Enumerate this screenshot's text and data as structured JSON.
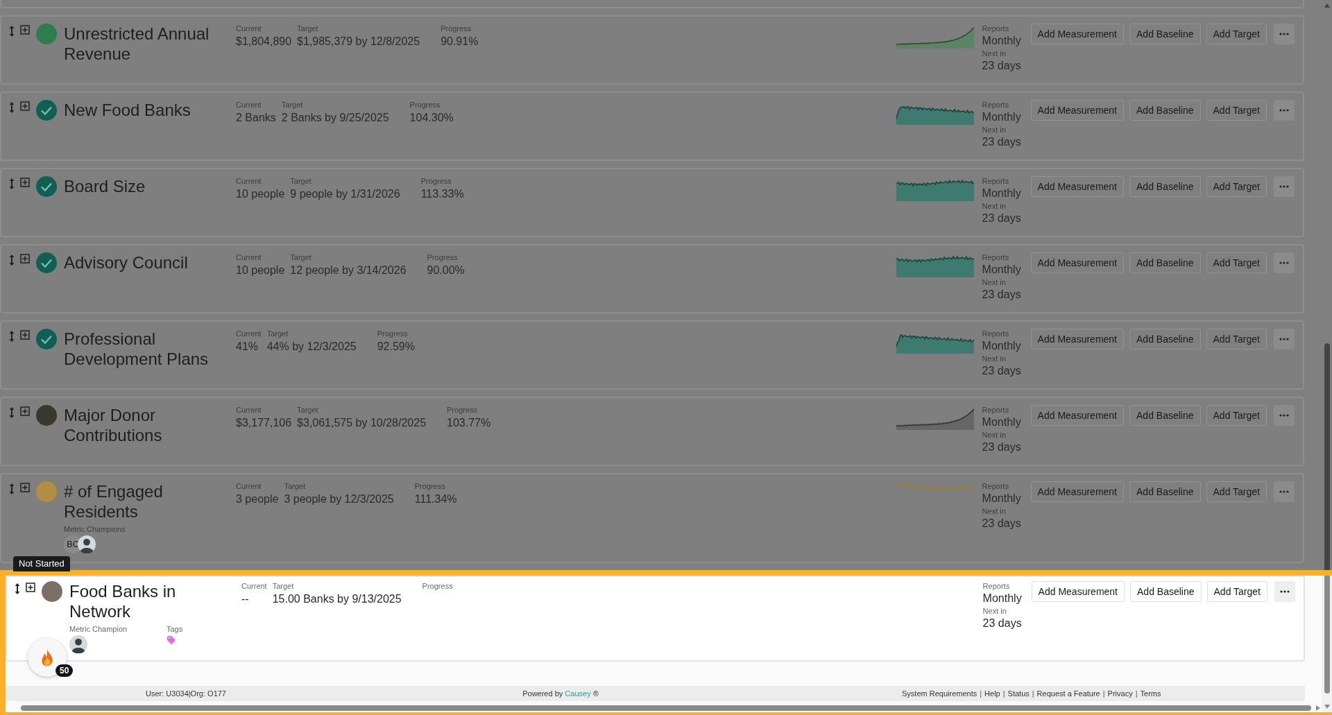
{
  "metrics": [
    {
      "title": "Unrestricted Annual Revenue",
      "status": {
        "kind": "dot",
        "color": "#2e7d4f"
      },
      "highlighted": false,
      "current_label": "Current",
      "current": "$1,804,890",
      "target_label": "Target",
      "target": "$1,985,379 by 12/8/2025",
      "progress_label": "Progress",
      "progress": "90.91%",
      "sparkline": {
        "kind": "area",
        "color": "#5e8466"
      },
      "reports_label": "Reports",
      "frequency": "Monthly",
      "next_label": "Next in",
      "next": "23 days",
      "buttons": [
        "Add Measurement",
        "Add Baseline",
        "Add Target"
      ]
    },
    {
      "title": "New Food Banks",
      "status": {
        "kind": "check",
        "color": "#0f5f55"
      },
      "highlighted": false,
      "current_label": "Current",
      "current": "2 Banks",
      "target_label": "Target",
      "target": "2 Banks by 9/25/2025",
      "progress_label": "Progress",
      "progress": "104.30%",
      "sparkline": {
        "kind": "area",
        "color": "#3f7a70"
      },
      "reports_label": "Reports",
      "frequency": "Monthly",
      "next_label": "Next in",
      "next": "23 days",
      "buttons": [
        "Add Measurement",
        "Add Baseline",
        "Add Target"
      ]
    },
    {
      "title": "Board Size",
      "status": {
        "kind": "check",
        "color": "#0f5f55"
      },
      "highlighted": false,
      "current_label": "Current",
      "current": "10 people",
      "target_label": "Target",
      "target": "9 people by 1/31/2026",
      "progress_label": "Progress",
      "progress": "113.33%",
      "sparkline": {
        "kind": "area",
        "color": "#3f7a70"
      },
      "reports_label": "Reports",
      "frequency": "Monthly",
      "next_label": "Next in",
      "next": "23 days",
      "buttons": [
        "Add Measurement",
        "Add Baseline",
        "Add Target"
      ]
    },
    {
      "title": "Advisory Council",
      "status": {
        "kind": "check",
        "color": "#0f5f55"
      },
      "highlighted": false,
      "current_label": "Current",
      "current": "10 people",
      "target_label": "Target",
      "target": "12 people by 3/14/2026",
      "progress_label": "Progress",
      "progress": "90.00%",
      "sparkline": {
        "kind": "area",
        "color": "#3f7a70"
      },
      "reports_label": "Reports",
      "frequency": "Monthly",
      "next_label": "Next in",
      "next": "23 days",
      "buttons": [
        "Add Measurement",
        "Add Baseline",
        "Add Target"
      ]
    },
    {
      "title": "Professional Development Plans",
      "status": {
        "kind": "check",
        "color": "#0f5f55"
      },
      "highlighted": false,
      "current_label": "Current",
      "current": "41%",
      "target_label": "Target",
      "target": "44% by 12/3/2025",
      "progress_label": "Progress",
      "progress": "92.59%",
      "sparkline": {
        "kind": "area",
        "color": "#3f7a70"
      },
      "reports_label": "Reports",
      "frequency": "Monthly",
      "next_label": "Next in",
      "next": "23 days",
      "buttons": [
        "Add Measurement",
        "Add Baseline",
        "Add Target"
      ]
    },
    {
      "title": "Major Donor Contributions",
      "status": {
        "kind": "dot",
        "color": "#3a3630"
      },
      "highlighted": false,
      "current_label": "Current",
      "current": "$3,177,106",
      "target_label": "Target",
      "target": "$3,061,575 by 10/28/2025",
      "progress_label": "Progress",
      "progress": "103.77%",
      "sparkline": {
        "kind": "area",
        "color": "#666666"
      },
      "reports_label": "Reports",
      "frequency": "Monthly",
      "next_label": "Next in",
      "next": "23 days",
      "buttons": [
        "Add Measurement",
        "Add Baseline",
        "Add Target"
      ]
    },
    {
      "title": "# of Engaged Residents",
      "status": {
        "kind": "dot",
        "color": "#b08f40"
      },
      "highlighted": false,
      "current_label": "Current",
      "current": "3 people",
      "target_label": "Target",
      "target": "3 people by 12/3/2025",
      "progress_label": "Progress",
      "progress": "111.34%",
      "sparkline": {
        "kind": "line",
        "color": "#a08030"
      },
      "reports_label": "Reports",
      "frequency": "Monthly",
      "next_label": "Next in",
      "next": "23 days",
      "buttons": [
        "Add Measurement",
        "Add Baseline",
        "Add Target"
      ],
      "champions_label": "Metric Champions",
      "champions": [
        {
          "kind": "initials",
          "initials": "BC"
        },
        {
          "kind": "avatar"
        }
      ]
    },
    {
      "title": "Food Banks in Network",
      "status": {
        "kind": "dot",
        "color": "#7a7068"
      },
      "highlighted": true,
      "tooltip": "Not Started",
      "current_label": "Current",
      "current": "--",
      "target_label": "Target",
      "target": "15.00 Banks by 9/13/2025",
      "progress_label": "Progress",
      "reports_label": "Reports",
      "frequency": "Monthly",
      "next_label": "Next in",
      "next": "23 days",
      "buttons": [
        "Add Measurement",
        "Add Baseline",
        "Add Target"
      ],
      "champions_label": "Metric Champion",
      "champions": [
        {
          "kind": "avatar"
        }
      ],
      "tags_label": "Tags",
      "tags": [
        {
          "color": "#e86ae6"
        }
      ]
    }
  ],
  "streak_badge": {
    "count": "50"
  },
  "footer": {
    "user": "User: U3034|Org: O177",
    "powered_by": "Powered by ",
    "brand": "Causey",
    "mark": " ®",
    "links": [
      "System Requirements",
      "Help",
      "Status",
      "Request a Feature",
      "Privacy",
      "Terms"
    ],
    "separator": "|"
  }
}
